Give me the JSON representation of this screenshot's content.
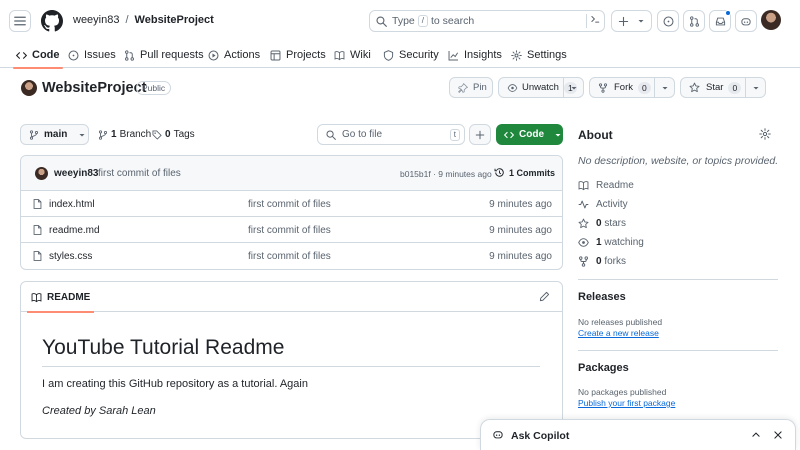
{
  "header": {
    "owner": "weeyin83",
    "separator": "/",
    "repo": "WebsiteProject",
    "search_prefix": "Type",
    "search_key": "/",
    "search_suffix": "to search"
  },
  "tabs": [
    {
      "label": "Code",
      "icon": "code-icon",
      "active": true
    },
    {
      "label": "Issues",
      "icon": "issue-icon"
    },
    {
      "label": "Pull requests",
      "icon": "pull-request-icon"
    },
    {
      "label": "Actions",
      "icon": "play-icon"
    },
    {
      "label": "Projects",
      "icon": "table-icon"
    },
    {
      "label": "Wiki",
      "icon": "book-icon"
    },
    {
      "label": "Security",
      "icon": "shield-icon"
    },
    {
      "label": "Insights",
      "icon": "graph-icon"
    },
    {
      "label": "Settings",
      "icon": "gear-icon"
    }
  ],
  "repo": {
    "name": "WebsiteProject",
    "visibility": "Public",
    "pin_label": "Pin",
    "watch_label": "Unwatch",
    "watch_count": "1",
    "fork_label": "Fork",
    "fork_count": "0",
    "star_label": "Star",
    "star_count": "0"
  },
  "filenav": {
    "branch": "main",
    "branch_count": "1",
    "branch_label": "Branch",
    "tag_count": "0",
    "tag_label": "Tags",
    "goto_placeholder": "Go to file",
    "goto_key": "t",
    "code_label": "Code"
  },
  "latest_commit": {
    "user": "weeyin83",
    "message": "first commit of files",
    "meta": "b015b1f · 9 minutes ago",
    "count_label": "1 Commits"
  },
  "files": [
    {
      "name": "index.html",
      "message": "first commit of files",
      "date": "9 minutes ago"
    },
    {
      "name": "readme.md",
      "message": "first commit of files",
      "date": "9 minutes ago"
    },
    {
      "name": "styles.css",
      "message": "first commit of files",
      "date": "9 minutes ago"
    }
  ],
  "readme": {
    "tab_label": "README",
    "heading": "YouTube Tutorial Readme",
    "paragraph": "I am creating this GitHub repository as a tutorial. Again",
    "emphasis": "Created by Sarah Lean"
  },
  "about": {
    "title": "About",
    "description": "No description, website, or topics provided.",
    "readme_label": "Readme",
    "activity_label": "Activity",
    "stars_count": "0",
    "stars_label": "stars",
    "watching_count": "1",
    "watching_label": "watching",
    "forks_count": "0",
    "forks_label": "forks"
  },
  "releases": {
    "title": "Releases",
    "note": "No releases published",
    "link": "Create a new release"
  },
  "packages": {
    "title": "Packages",
    "note": "No packages published",
    "link": "Publish your first package"
  },
  "copilot": {
    "label": "Ask Copilot"
  },
  "colors": {
    "accent_tab": "#fd8c73",
    "code_button": "#1f883d",
    "link": "#0969da",
    "border": "#d1d9e0",
    "muted": "#59636e"
  }
}
